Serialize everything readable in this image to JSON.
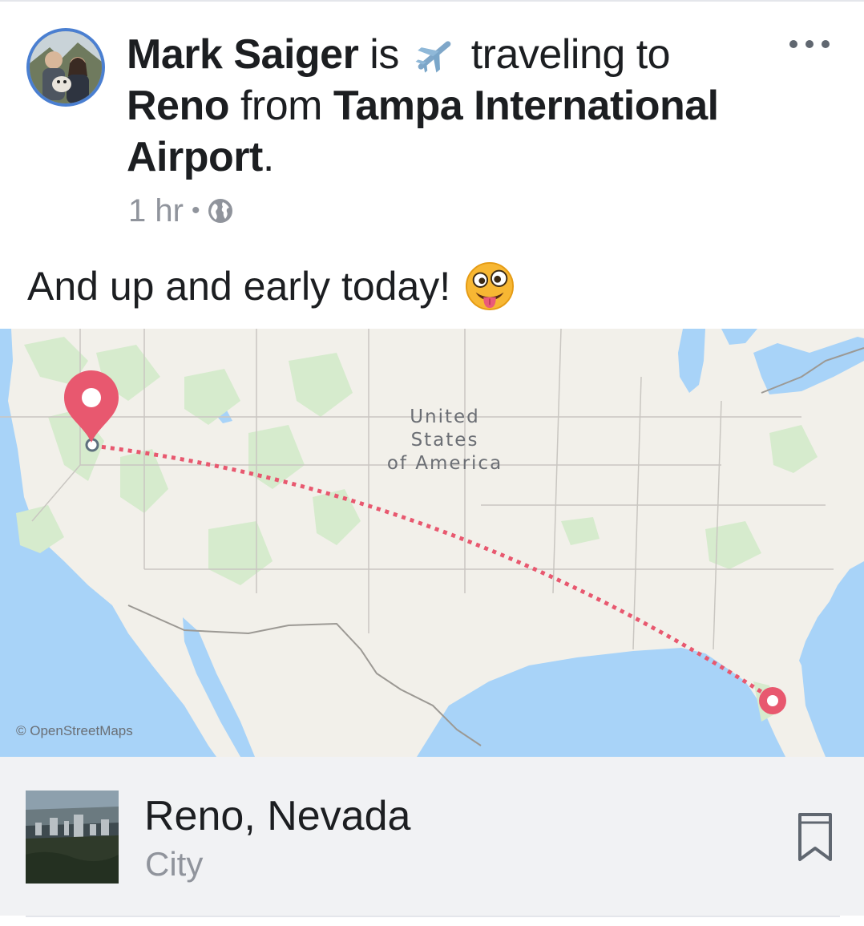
{
  "post": {
    "author": "Mark Saiger",
    "verb_is": "is",
    "activity": "traveling to",
    "destination": "Reno",
    "from_word": "from",
    "origin": "Tampa International Airport",
    "period": ".",
    "time": "1 hr",
    "separator": "•",
    "audience_icon": "globe-icon",
    "activity_icon": "airplane-icon",
    "text": "And up and early today!",
    "text_emoji": "crazy-face-emoji"
  },
  "map": {
    "country_label_line1": "United",
    "country_label_line2": "States",
    "country_label_line3": "of America",
    "attribution": "© OpenStreetMaps",
    "route_color": "#e8586f",
    "water_color": "#a8d3f8",
    "land_color": "#f2f0ea",
    "park_color": "#d6ebcd"
  },
  "place": {
    "name": "Reno, Nevada",
    "type": "City",
    "bookmark_icon": "bookmark-icon"
  },
  "colors": {
    "avatar_ring": "#4a7fd1",
    "text_primary": "#1c1e21",
    "text_secondary": "#90949c",
    "place_background": "#f1f2f4"
  }
}
